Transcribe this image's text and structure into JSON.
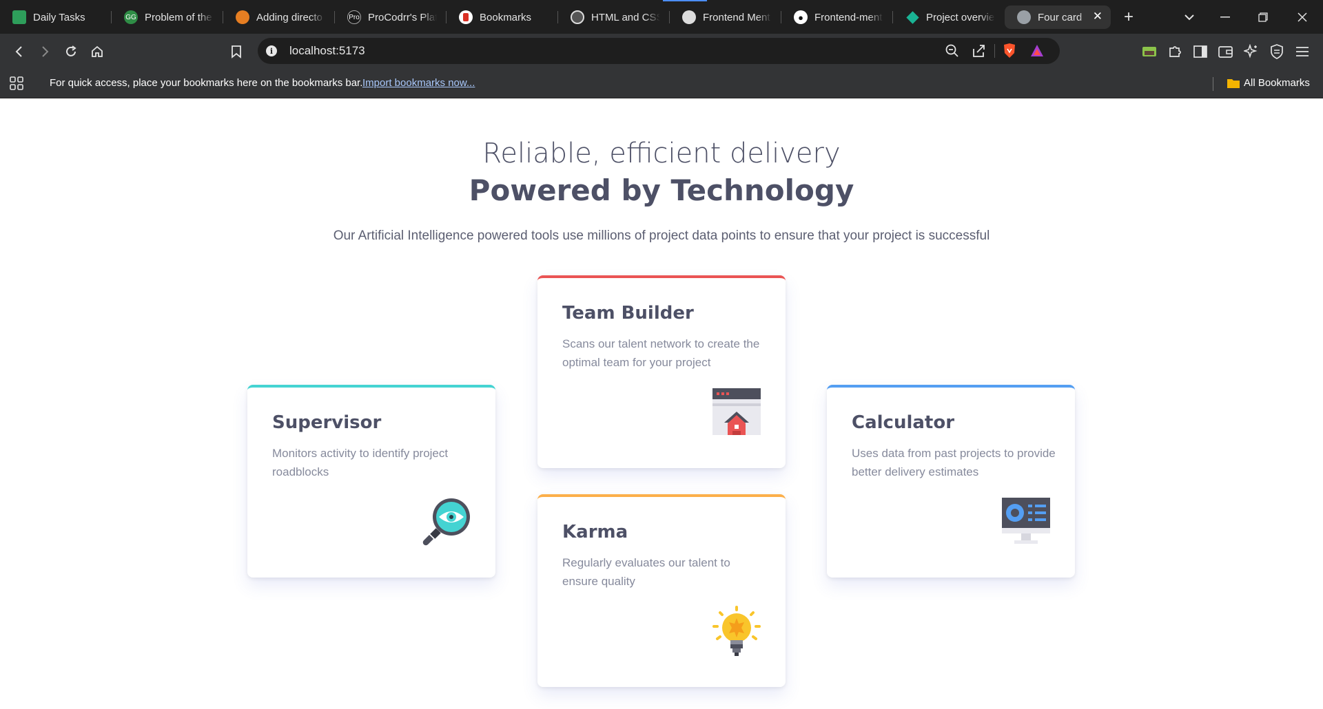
{
  "browser": {
    "tabs": [
      {
        "label": "Daily Tasks",
        "favicon": "sheet-icon",
        "color": "#2e9e5b"
      },
      {
        "label": "Problem of the",
        "favicon": "gfg-icon",
        "color": "#2f8d46"
      },
      {
        "label": "Adding directo",
        "favicon": "blogger-icon",
        "color": "#e67e22"
      },
      {
        "label": "ProCodrr's Plat",
        "favicon": "procodrr-icon",
        "color": "#1a1a1a"
      },
      {
        "label": "Bookmarks",
        "favicon": "bookmark-site-icon",
        "color": "#d93025"
      },
      {
        "label": "HTML and CSS",
        "favicon": "course-icon",
        "color": "#555555"
      },
      {
        "label": "Frontend Ment",
        "favicon": "fm-icon",
        "color": "#dddddd"
      },
      {
        "label": "Frontend-ment",
        "favicon": "github-icon",
        "color": "#ffffff"
      },
      {
        "label": "Project overvie",
        "favicon": "diamond-icon",
        "color": "#1ab394"
      },
      {
        "label": "Four card",
        "favicon": "globe-icon",
        "color": "#9aa0a6"
      }
    ],
    "address": "localhost:5173",
    "bookmarks_bar": {
      "message": "For quick access, place your bookmarks here on the bookmarks bar.",
      "import_link": "Import bookmarks now...",
      "all_bookmarks": "All Bookmarks"
    }
  },
  "page": {
    "heading_light": "Reliable, efficient delivery",
    "heading_bold": "Powered by Technology",
    "intro": "Our Artificial Intelligence powered tools use millions of project data points to ensure that your project is successful",
    "cards": {
      "supervisor": {
        "title": "Supervisor",
        "text": "Monitors activity to identify project roadblocks",
        "accent": "#44d3d2"
      },
      "team_builder": {
        "title": "Team Builder",
        "text": "Scans our talent network to create the optimal team for your project",
        "accent": "#ea5454"
      },
      "karma": {
        "title": "Karma",
        "text": "Regularly evaluates our talent to ensure quality",
        "accent": "#fcaf4a"
      },
      "calculator": {
        "title": "Calculator",
        "text": "Uses data from past projects to provide better delivery estimates",
        "accent": "#549ef2"
      }
    }
  }
}
